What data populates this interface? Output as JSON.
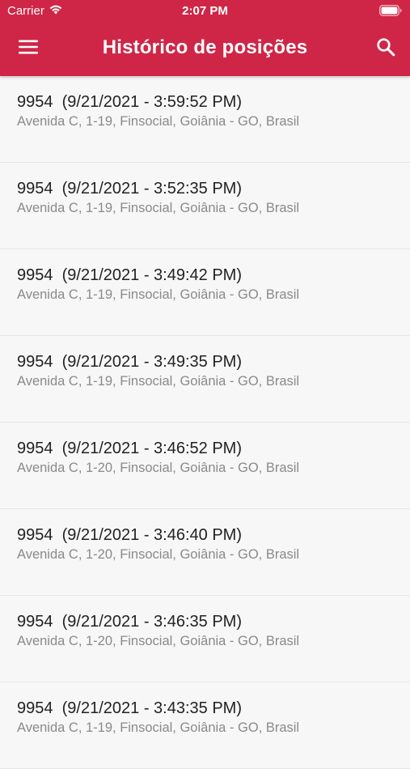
{
  "status_bar": {
    "carrier": "Carrier",
    "time": "2:07 PM",
    "icons": [
      "wifi-icon",
      "battery-icon"
    ]
  },
  "header": {
    "title": "Histórico de posições",
    "background_color": "#cf2647",
    "menu_icon": "hamburger-menu-icon",
    "search_icon": "search-icon"
  },
  "positions": [
    {
      "id": "9954",
      "datetime": "(9/21/2021 - 3:59:52 PM)",
      "address": "Avenida C, 1-19, Finsocial, Goiânia - GO, Brasil"
    },
    {
      "id": "9954",
      "datetime": "(9/21/2021 - 3:52:35 PM)",
      "address": "Avenida C, 1-19, Finsocial, Goiânia - GO, Brasil"
    },
    {
      "id": "9954",
      "datetime": "(9/21/2021 - 3:49:42 PM)",
      "address": "Avenida C, 1-19, Finsocial, Goiânia - GO, Brasil"
    },
    {
      "id": "9954",
      "datetime": "(9/21/2021 - 3:49:35 PM)",
      "address": "Avenida C, 1-19, Finsocial, Goiânia - GO, Brasil"
    },
    {
      "id": "9954",
      "datetime": "(9/21/2021 - 3:46:52 PM)",
      "address": "Avenida C, 1-20, Finsocial, Goiânia - GO, Brasil"
    },
    {
      "id": "9954",
      "datetime": "(9/21/2021 - 3:46:40 PM)",
      "address": "Avenida C, 1-20, Finsocial, Goiânia - GO, Brasil"
    },
    {
      "id": "9954",
      "datetime": "(9/21/2021 - 3:46:35 PM)",
      "address": "Avenida C, 1-20, Finsocial, Goiânia - GO, Brasil"
    },
    {
      "id": "9954",
      "datetime": "(9/21/2021 - 3:43:35 PM)",
      "address": "Avenida C, 1-19, Finsocial, Goiânia - GO, Brasil"
    }
  ]
}
